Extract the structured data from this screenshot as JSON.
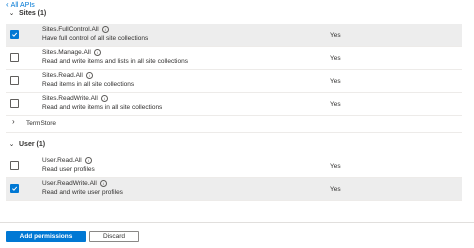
{
  "back_link": {
    "label": "All APIs"
  },
  "groups": [
    {
      "title": "Sites (1)",
      "permissions": [
        {
          "name": "Sites.FullControl.All",
          "description": "Have full control of all site collections",
          "admin_consent": "Yes",
          "checked": true
        },
        {
          "name": "Sites.Manage.All",
          "description": "Read and write items and lists in all site collections",
          "admin_consent": "Yes",
          "checked": false
        },
        {
          "name": "Sites.Read.All",
          "description": "Read items in all site collections",
          "admin_consent": "Yes",
          "checked": false
        },
        {
          "name": "Sites.ReadWrite.All",
          "description": "Read and write items in all site collections",
          "admin_consent": "Yes",
          "checked": false
        }
      ]
    },
    {
      "title": "TermStore",
      "collapsed": true
    },
    {
      "title": "User (1)",
      "permissions": [
        {
          "name": "User.Read.All",
          "description": "Read user profiles",
          "admin_consent": "Yes",
          "checked": false
        },
        {
          "name": "User.ReadWrite.All",
          "description": "Read and write user profiles",
          "admin_consent": "Yes",
          "checked": true
        }
      ]
    }
  ],
  "footer": {
    "add_label": "Add permissions",
    "discard_label": "Discard"
  },
  "colors": {
    "accent": "#0078d4",
    "selected_row": "#ededed"
  },
  "icons": {
    "back": "chevron-left-icon",
    "expanded": "chevron-down-icon",
    "collapsed": "chevron-right-icon",
    "info": "info-icon",
    "check": "checkmark-icon"
  }
}
